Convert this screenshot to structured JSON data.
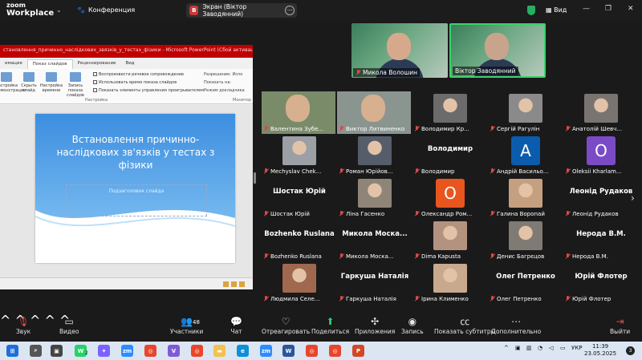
{
  "titlebar": {
    "app_line1": "zoom",
    "app_line2": "Workplace",
    "meeting": "Конференция",
    "screen_badge": "В",
    "screen_label": "Экран (Віктор Заводянний)",
    "view": "Вид"
  },
  "share": {
    "ppt_title": "становлення_причинно_наслідкових_звязків_у_тестах_фізики - Microsoft PowerPoint (Сбой активации продукта)",
    "tabs": [
      "имация",
      "Показ слайдов",
      "Рецензирование",
      "Вид"
    ],
    "ribbon_buttons": [
      "Настройка демонстрации",
      "Скрыть слайд",
      "Настройка времени",
      "Запись показа слайдов"
    ],
    "checks": [
      "Воспроизвести речевое сопровождение",
      "Использовать время показа слайдов",
      "Показать элементы управления проигрывателем"
    ],
    "right_items": [
      "Разрешение:",
      "Показать на:",
      "Режим докладчика"
    ],
    "right_value": "Испо",
    "group_label": "Настройка",
    "group_label2": "Монитор",
    "slide_title": "Встановлення причинно-наслідкових зв'язків у тестах з фізики",
    "slide_subtitle": "Подзаголовок слайда"
  },
  "speakers": [
    {
      "name": "Микола Волошин"
    },
    {
      "name": "Віктор Заводянний"
    }
  ],
  "gallery": [
    {
      "kind": "video",
      "name": "Валентина Зубе...",
      "color": "#7a8b6a"
    },
    {
      "kind": "video",
      "name": "Виктор Литвиненко",
      "color": "#8a9590"
    },
    {
      "kind": "photo",
      "name": "Володимир Кр...",
      "color": "#6b6b6b"
    },
    {
      "kind": "photo",
      "name": "Сергій Рагулін",
      "color": "#8a8a8a"
    },
    {
      "kind": "photo",
      "name": "Анатолій Шевч...",
      "color": "#7a7470"
    },
    {
      "kind": "photo",
      "name": "Mechyslav Chek...",
      "color": "#9aa0a5"
    },
    {
      "kind": "photo",
      "name": "Роман Юрійов...",
      "color": "#555d6b"
    },
    {
      "kind": "text",
      "label": "Володимир",
      "name": "Володимир"
    },
    {
      "kind": "avatar",
      "letter": "A",
      "name": "Андрій Васильо...",
      "color": "#0b5cad"
    },
    {
      "kind": "avatar",
      "letter": "O",
      "name": "Oleksii Kharlam...",
      "color": "#7b4bc6"
    },
    {
      "kind": "text",
      "label": "Шостак Юрій",
      "name": "Шостак Юрій"
    },
    {
      "kind": "photo",
      "name": "Ліна Гасенко",
      "color": "#8f8478"
    },
    {
      "kind": "avatar",
      "letter": "O",
      "name": "Олександр Ром...",
      "color": "#e8551f"
    },
    {
      "kind": "photo",
      "name": "Галина Воропай",
      "color": "#c5a080"
    },
    {
      "kind": "text",
      "label": "Леонід Рудаков",
      "name": "Леонід Рудаков"
    },
    {
      "kind": "text",
      "label": "Bozhenko Ruslana",
      "name": "Bozhenko Ruslana"
    },
    {
      "kind": "text",
      "label": "Микола Моска...",
      "name": "Микола Моска..."
    },
    {
      "kind": "photo",
      "name": "Dima Kapusta",
      "color": "#b39380"
    },
    {
      "kind": "photo",
      "name": "Денис Багрєцов",
      "color": "#7f7a73"
    },
    {
      "kind": "text",
      "label": "Нерода В.М.",
      "name": "Нерода В.М."
    },
    {
      "kind": "photo",
      "name": "Людмила Селе...",
      "color": "#a0684f"
    },
    {
      "kind": "text",
      "label": "Гаркуша Наталія",
      "name": "Гаркуша Наталія"
    },
    {
      "kind": "photo",
      "name": "Ірина Клименко",
      "color": "#c9a98e"
    },
    {
      "kind": "text",
      "label": "Олег Петренко",
      "name": "Олег Петренко"
    },
    {
      "kind": "text",
      "label": "Юрій Флотер",
      "name": "Юрій Флотер"
    }
  ],
  "toolbar": {
    "mute": "Звук",
    "video": "Видео",
    "participants": "Участники",
    "participants_count": "48",
    "chat": "Чат",
    "react": "Отреагировать",
    "share": "Поделиться",
    "apps": "Приложения",
    "record": "Запись",
    "captions": "Показать субтитры",
    "more": "Дополнительно",
    "leave": "Выйти"
  },
  "taskbar": {
    "badge": "2",
    "lang": "УКР",
    "time": "11:39",
    "date": "23.05.2025",
    "notif": "3"
  },
  "colors": {
    "accent_green": "#3ad16b",
    "ppt_red": "#c00000",
    "muted_red": "#e04848"
  }
}
